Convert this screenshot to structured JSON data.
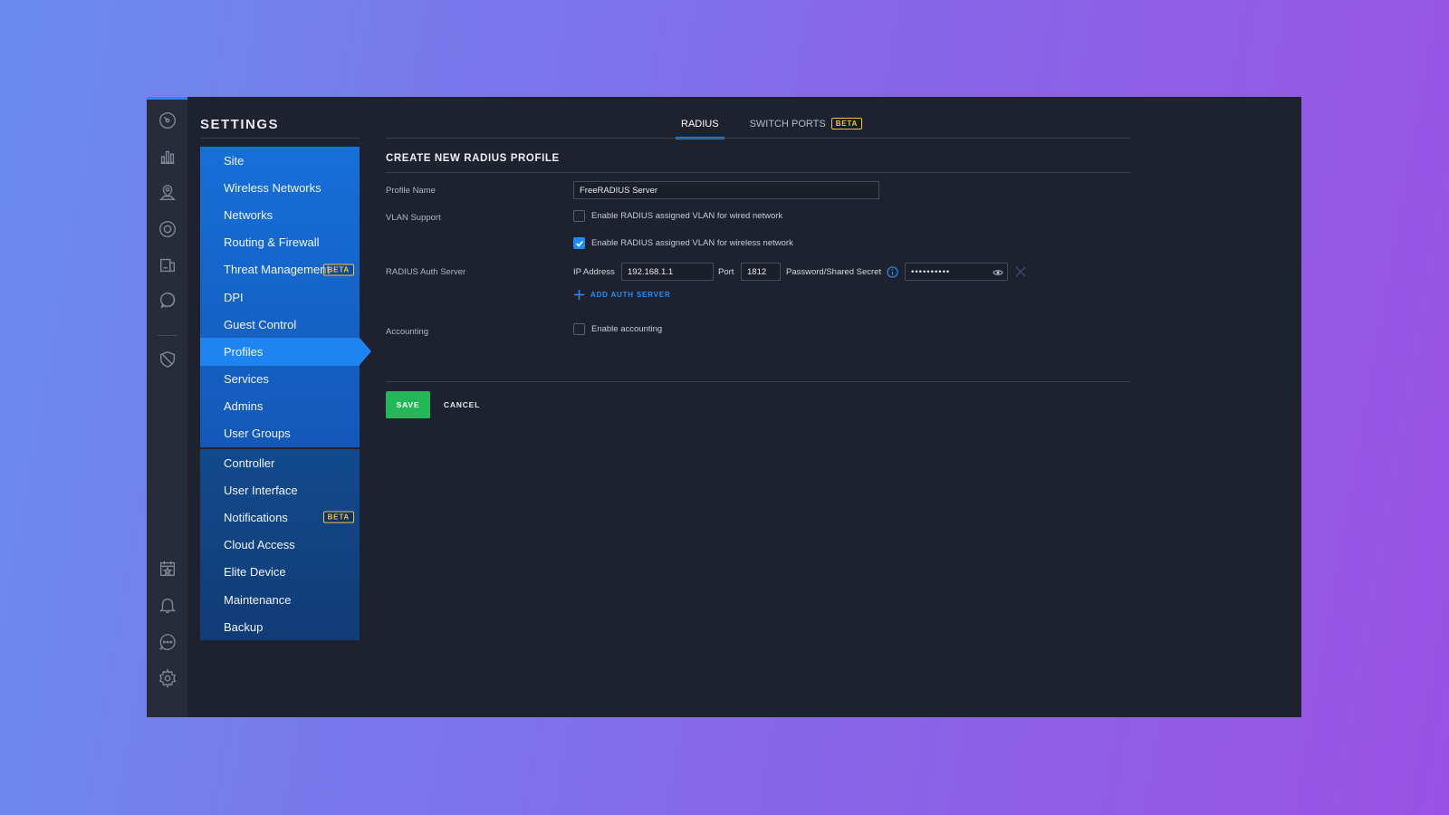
{
  "rail": {
    "icons": [
      "dashboard-icon",
      "statistics-icon",
      "map-icon",
      "devices-icon",
      "clients-icon",
      "insights-icon",
      "shield-icon",
      "events-icon",
      "alerts-icon",
      "chat-icon",
      "gear-icon"
    ]
  },
  "settings": {
    "title": "SETTINGS",
    "menu_group1": [
      {
        "label": "Site"
      },
      {
        "label": "Wireless Networks"
      },
      {
        "label": "Networks"
      },
      {
        "label": "Routing & Firewall"
      },
      {
        "label": "Threat Management",
        "badge": "BETA"
      },
      {
        "label": "DPI"
      },
      {
        "label": "Guest Control"
      },
      {
        "label": "Profiles",
        "active": true
      },
      {
        "label": "Services"
      },
      {
        "label": "Admins"
      },
      {
        "label": "User Groups"
      }
    ],
    "menu_group2": [
      {
        "label": "Controller"
      },
      {
        "label": "User Interface"
      },
      {
        "label": "Notifications",
        "badge": "BETA"
      },
      {
        "label": "Cloud Access"
      },
      {
        "label": "Elite Device"
      },
      {
        "label": "Maintenance"
      },
      {
        "label": "Backup"
      }
    ]
  },
  "tabs": {
    "radius": "RADIUS",
    "switch_ports": "SWITCH PORTS",
    "switch_ports_badge": "BETA"
  },
  "form": {
    "title": "CREATE NEW RADIUS PROFILE",
    "profile_name_label": "Profile Name",
    "profile_name_value": "FreeRADIUS Server",
    "vlan_label": "VLAN Support",
    "vlan_wired": "Enable RADIUS assigned VLAN for wired network",
    "vlan_wired_checked": false,
    "vlan_wireless": "Enable RADIUS assigned VLAN for wireless network",
    "vlan_wireless_checked": true,
    "auth_server_label": "RADIUS Auth Server",
    "ip_label": "IP Address",
    "ip_value": "192.168.1.1",
    "port_label": "Port",
    "port_value": "1812",
    "secret_label": "Password/Shared Secret",
    "secret_value": "••••••••••",
    "add_auth_server": "ADD AUTH SERVER",
    "accounting_label": "Accounting",
    "enable_accounting": "Enable accounting",
    "enable_accounting_checked": false,
    "save": "SAVE",
    "cancel": "CANCEL"
  },
  "colors": {
    "accent": "#1f8bf5",
    "save": "#22b857",
    "badge": "#f6c343"
  }
}
